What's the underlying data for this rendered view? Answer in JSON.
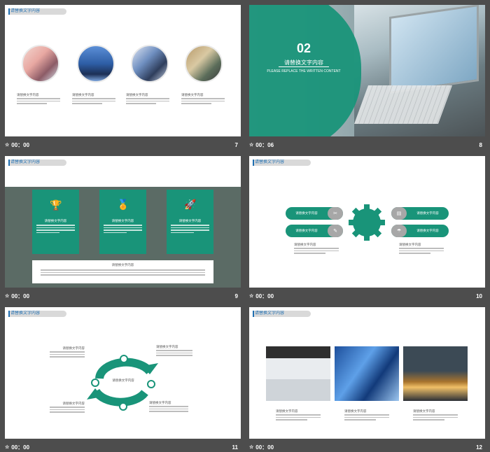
{
  "slides": {
    "s7": {
      "tag": "请替换文字内容",
      "time": "00：00",
      "number": "7",
      "captions": [
        "请替换文字内容",
        "请替换文字内容",
        "请替换文字内容",
        "请替换文字内容"
      ]
    },
    "s8": {
      "time": "00：06",
      "number": "8",
      "section": "02",
      "title": "请替换文字内容",
      "subtitle": "PLEASE REPLACE THE WRITTEN CONTENT"
    },
    "s9": {
      "tag": "请替换文字内容",
      "time": "00：00",
      "number": "9",
      "cards": [
        "请替换文字内容",
        "请替换文字内容",
        "请替换文字内容"
      ],
      "bottom_label": "请替换文字内容"
    },
    "s10": {
      "tag": "请替换文字内容",
      "time": "00：00",
      "number": "10",
      "pills_left": [
        "请替换文字内容",
        "请替换文字内容"
      ],
      "pills_right": [
        "请替换文字内容",
        "请替换文字内容"
      ],
      "captions": [
        "请替换文字内容",
        "请替换文字内容"
      ]
    },
    "s11": {
      "tag": "请替换文字内容",
      "time": "00：00",
      "number": "11",
      "labels": [
        "请替换文字内容",
        "请替换文字内容",
        "请替换文字内容",
        "请替换文字内容",
        "请替换文字内容"
      ]
    },
    "s12": {
      "tag": "请替换文字内容",
      "time": "00：00",
      "number": "12",
      "captions": [
        "请替换文字内容",
        "请替换文字内容",
        "请替换文字内容"
      ]
    }
  },
  "colors": {
    "accent": "#199479",
    "background": "#4d4d4d",
    "tag": "#1f6fb2"
  },
  "icons": [
    "trophy-icon",
    "award-icon",
    "rocket-icon",
    "tools-icon",
    "pencil-icon",
    "document-icon",
    "umbrella-icon",
    "star-icon"
  ]
}
